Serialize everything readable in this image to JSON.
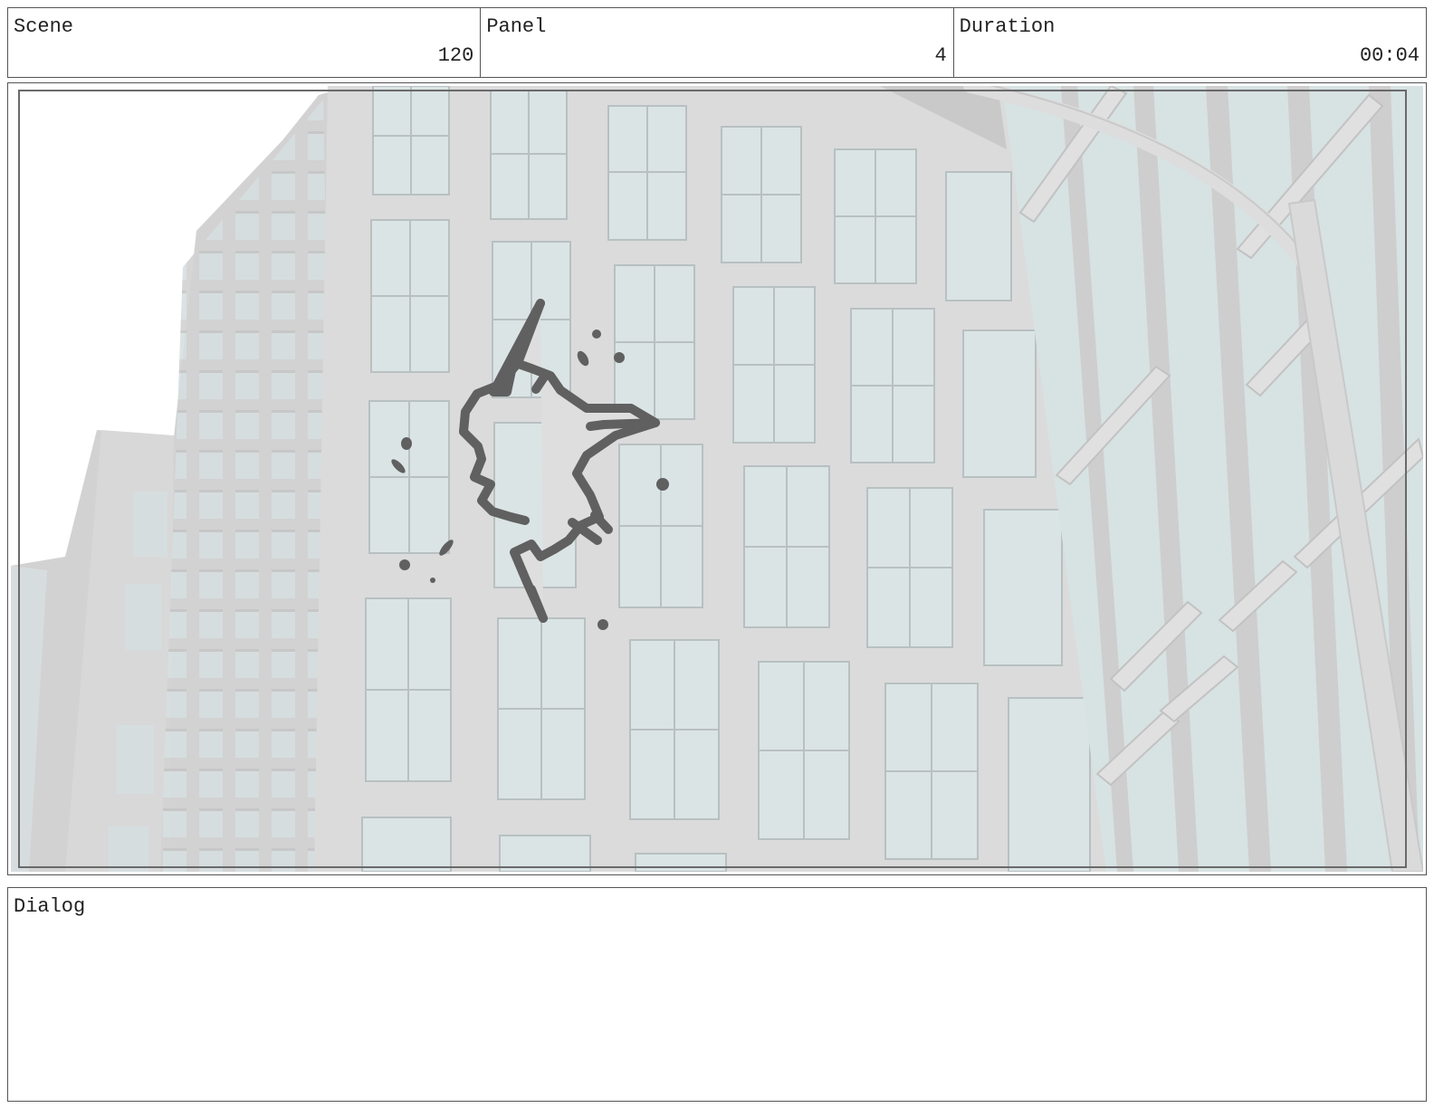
{
  "header": {
    "scene": {
      "label": "Scene",
      "value": "120"
    },
    "panel": {
      "label": "Panel",
      "value": "4"
    },
    "duration": {
      "label": "Duration",
      "value": "00:04"
    }
  },
  "dialog": {
    "label": "Dialog"
  },
  "colors": {
    "sketch": "#606060",
    "glass": "#d3dfe0",
    "wall": "#d2d2d2"
  }
}
